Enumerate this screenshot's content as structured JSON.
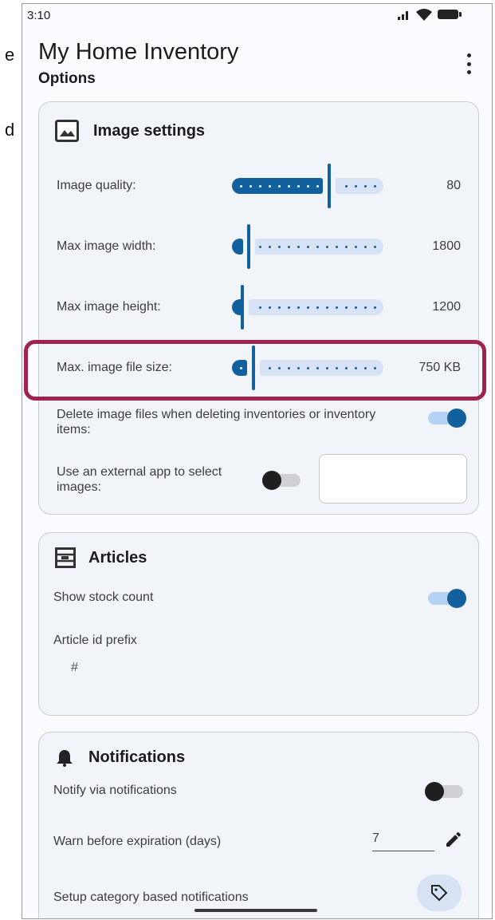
{
  "side": {
    "e": "e",
    "d": "d"
  },
  "status": {
    "time": "3:10"
  },
  "app": {
    "title": "My Home Inventory",
    "subtitle": "Options"
  },
  "image_settings": {
    "header": "Image settings",
    "image_quality": {
      "label": "Image quality:",
      "value": "80",
      "fraction": 0.63
    },
    "max_width": {
      "label": "Max image width:",
      "value": "1800",
      "fraction": 0.1
    },
    "max_height": {
      "label": "Max image height:",
      "value": "1200",
      "fraction": 0.06
    },
    "max_file_size": {
      "label": "Max. image file size:",
      "value": "750 KB",
      "fraction": 0.13
    },
    "delete_files": {
      "label": "Delete image files when deleting inventories or inventory items:",
      "on": true
    },
    "external_app": {
      "label": "Use an external app to select images:",
      "on": false
    }
  },
  "articles": {
    "header": "Articles",
    "show_stock": {
      "label": "Show stock count",
      "on": true
    },
    "prefix": {
      "label": "Article id prefix",
      "value": "#"
    }
  },
  "notifications": {
    "header": "Notifications",
    "notify": {
      "label": "Notify via notifications",
      "on": false
    },
    "warn": {
      "label": "Warn before expiration (days)",
      "value": "7"
    },
    "category": {
      "label": "Setup category based notifications"
    }
  },
  "colors": {
    "accent": "#12609e",
    "track": "#d7e3f5",
    "highlight": "#a3214e"
  }
}
